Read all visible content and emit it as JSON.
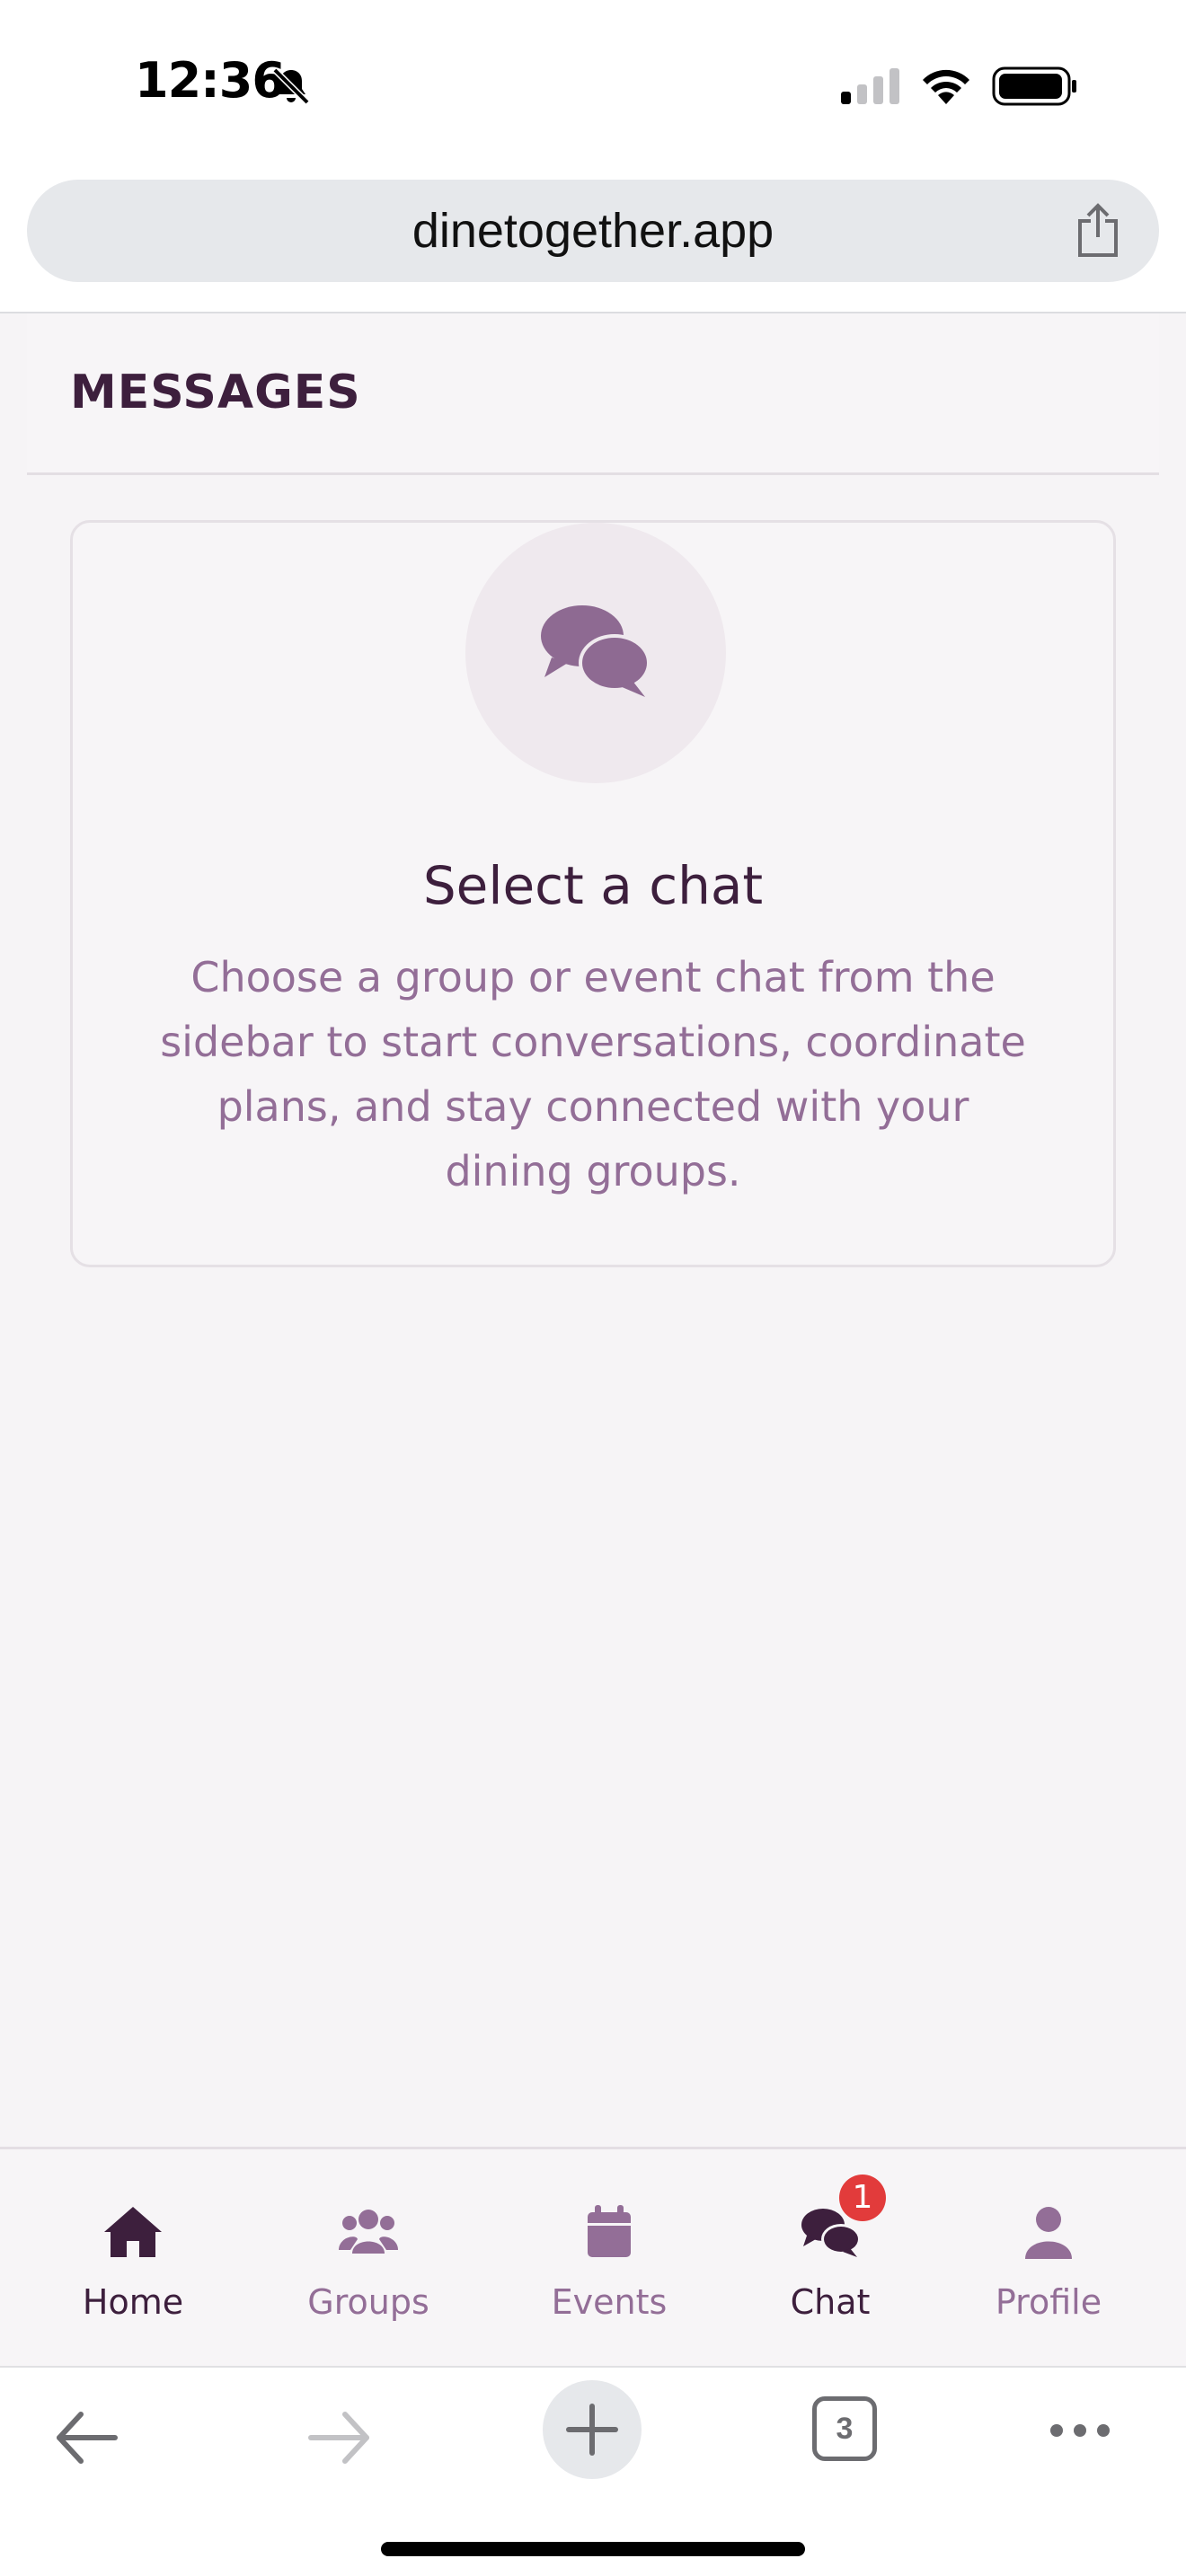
{
  "status_bar": {
    "time": "12:36",
    "icons": [
      "bell-slash-icon",
      "cellular-signal-icon",
      "wifi-icon",
      "battery-icon"
    ]
  },
  "browser": {
    "url": "dinetogether.app",
    "tab_count": "3",
    "icons": [
      "share-icon",
      "back-arrow-icon",
      "forward-arrow-icon",
      "plus-icon",
      "tabs-icon",
      "more-icon"
    ]
  },
  "page": {
    "header_title": "MESSAGES",
    "empty_state": {
      "icon": "chat-bubbles-icon",
      "title": "Select a chat",
      "description": "Choose a group or event chat from the sidebar to start conversations, coordinate plans, and stay connected with your dining groups."
    }
  },
  "tab_bar": {
    "items": [
      {
        "label": "Home",
        "icon": "home-icon",
        "active": false
      },
      {
        "label": "Groups",
        "icon": "groups-icon",
        "active": false
      },
      {
        "label": "Events",
        "icon": "calendar-icon",
        "active": false
      },
      {
        "label": "Chat",
        "icon": "chat-icon",
        "active": true,
        "badge": "1"
      },
      {
        "label": "Profile",
        "icon": "user-icon",
        "active": false
      }
    ]
  },
  "colors": {
    "primary_dark": "#3d1f3d",
    "muted_purple": "#936e97",
    "badge_red": "#e23b3b",
    "app_background": "#f6f4f6"
  }
}
